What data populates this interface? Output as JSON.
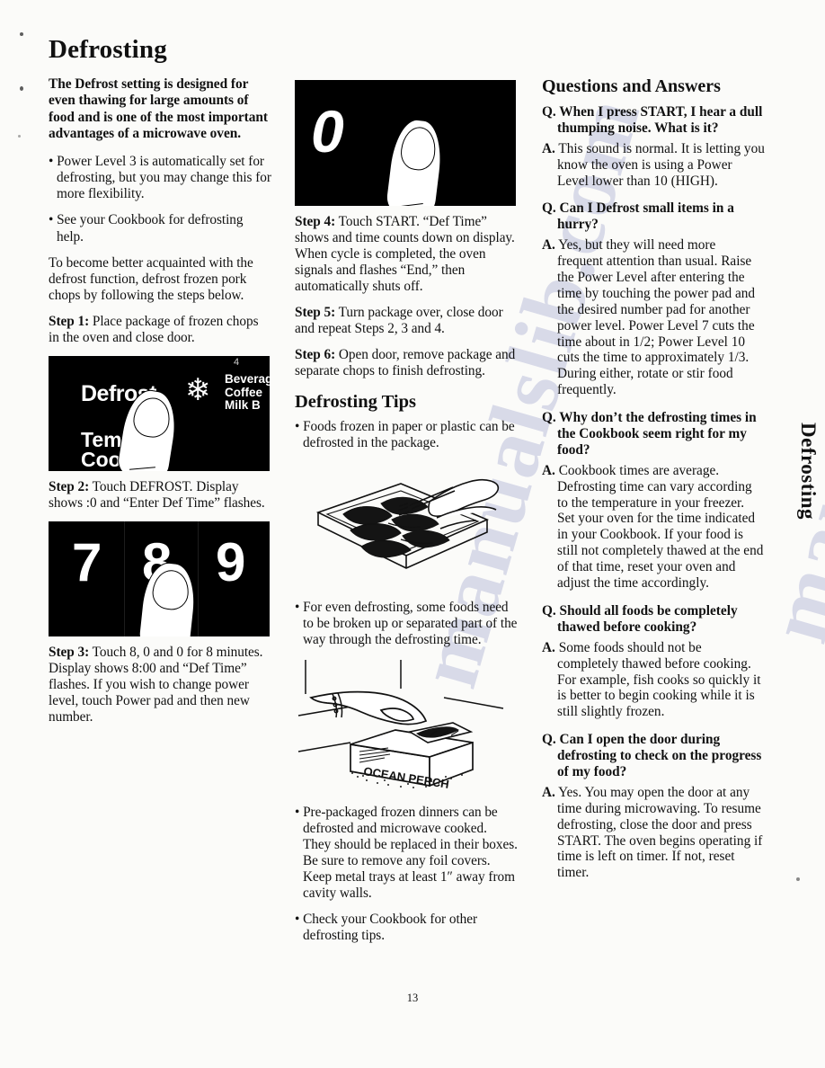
{
  "page": {
    "title": "Defrosting",
    "side_tab": "Defrosting",
    "page_number": "13",
    "watermark": "manualslib.com"
  },
  "left_column": {
    "lead_paragraph": "The Defrost setting is designed for even thawing for large amounts of food and is one of the most important advantages of a microwave oven.",
    "bullets": [
      "• Power Level 3 is automatically set for defrosting, but you may change this for more flexibility.",
      "• See your Cookbook for defrosting help."
    ],
    "intro_paragraph": "To become better acquainted with the defrost function, defrost frozen pork chops by following the steps below.",
    "step1": {
      "label": "Step 1:",
      "text": " Place package of frozen chops in the oven and close door."
    },
    "photo_defrost": {
      "name": "microwave-control-panel-defrost-pad",
      "labels": {
        "defrost": "Defrost",
        "temp_cook": "Temp\nCook",
        "right_stack": "Beverage\nCoffee\nMilk B",
        "top_number": "4",
        "snowflake": "❄"
      }
    },
    "step2": {
      "label": "Step 2:",
      "text": " Touch DEFROST. Display shows :0 and “Enter Def Time” flashes."
    },
    "photo_keys": {
      "name": "microwave-number-pad-789",
      "digits": [
        "7",
        "8",
        "9"
      ]
    },
    "step3": {
      "label": "Step 3:",
      "text": " Touch 8, 0 and 0 for 8 minutes. Display shows 8:00 and “Def Time” flashes. If you wish to change power level, touch Power pad and then new number."
    }
  },
  "middle_column": {
    "photo_zero": {
      "name": "microwave-display-zero",
      "digit": "0"
    },
    "step4": {
      "label": "Step 4:",
      "text": " Touch START. “Def Time” shows and time counts down on display. When cycle is completed, the oven signals and flashes “End,” then automatically shuts off."
    },
    "step5": {
      "label": "Step 5:",
      "text": " Turn package over, close door and repeat Steps 2, 3 and 4."
    },
    "step6": {
      "label": "Step 6:",
      "text": " Open door, remove package and separate chops to finish defrosting."
    },
    "tips_heading": "Defrosting Tips",
    "tip1": "• Foods frozen in paper or plastic can be defrosted in the package.",
    "drawing_chops": {
      "name": "illustration-separating-pork-chops-on-tray"
    },
    "tip2": "• For even defrosting, some foods need to be broken up or separated part of the way through the defrosting time.",
    "drawing_dinner": {
      "name": "illustration-frozen-dinner-box",
      "box_label": "OCEAN PERCH"
    },
    "tip3": "• Pre-packaged frozen dinners can be defrosted and microwave cooked. They should be replaced in their boxes. Be sure to remove any foil covers. Keep metal trays at least 1″ away from cavity walls.",
    "tip4": "• Check your Cookbook for other defrosting tips."
  },
  "right_column": {
    "heading": "Questions and Answers",
    "qa": [
      {
        "q_marker": "Q.",
        "question": "  When I press START, I hear a dull thumping noise. What is it?",
        "a_marker": "A.",
        "answer": "  This sound is normal. It is letting you know the oven is using a Power Level lower than 10 (HIGH)."
      },
      {
        "q_marker": "Q.",
        "question": "  Can I Defrost small items in a hurry?",
        "a_marker": "A.",
        "answer": "  Yes, but they will need more frequent attention than usual. Raise the Power Level after entering the time by touching the power pad and the desired number pad for another power level. Power Level 7 cuts the time about in 1/2; Power Level 10 cuts the time to approximately 1/3. During either, rotate or stir food frequently."
      },
      {
        "q_marker": "Q.",
        "question": "  Why don’t the defrosting times in the Cookbook seem right for my food?",
        "a_marker": "A.",
        "answer": "  Cookbook times are average. Defrosting time can vary according to the temperature in your freezer. Set your oven for the time indicated in your Cookbook. If your food is still not completely thawed at the end of that time, reset your oven and adjust the time accordingly."
      },
      {
        "q_marker": "Q.",
        "question": "  Should all foods be completely thawed before cooking?",
        "a_marker": "A.",
        "answer": "  Some foods should not be completely thawed before cooking. For example, fish cooks so quickly it is better to begin cooking while it is still slightly frozen."
      },
      {
        "q_marker": "Q.",
        "question": "  Can I open the door during defrosting to check on the progress of my food?",
        "a_marker": "A.",
        "answer": "  Yes. You may open the door at any time during microwaving. To resume defrosting, close the door and press START. The oven begins operating if time is left on timer. If not, reset timer."
      }
    ]
  }
}
